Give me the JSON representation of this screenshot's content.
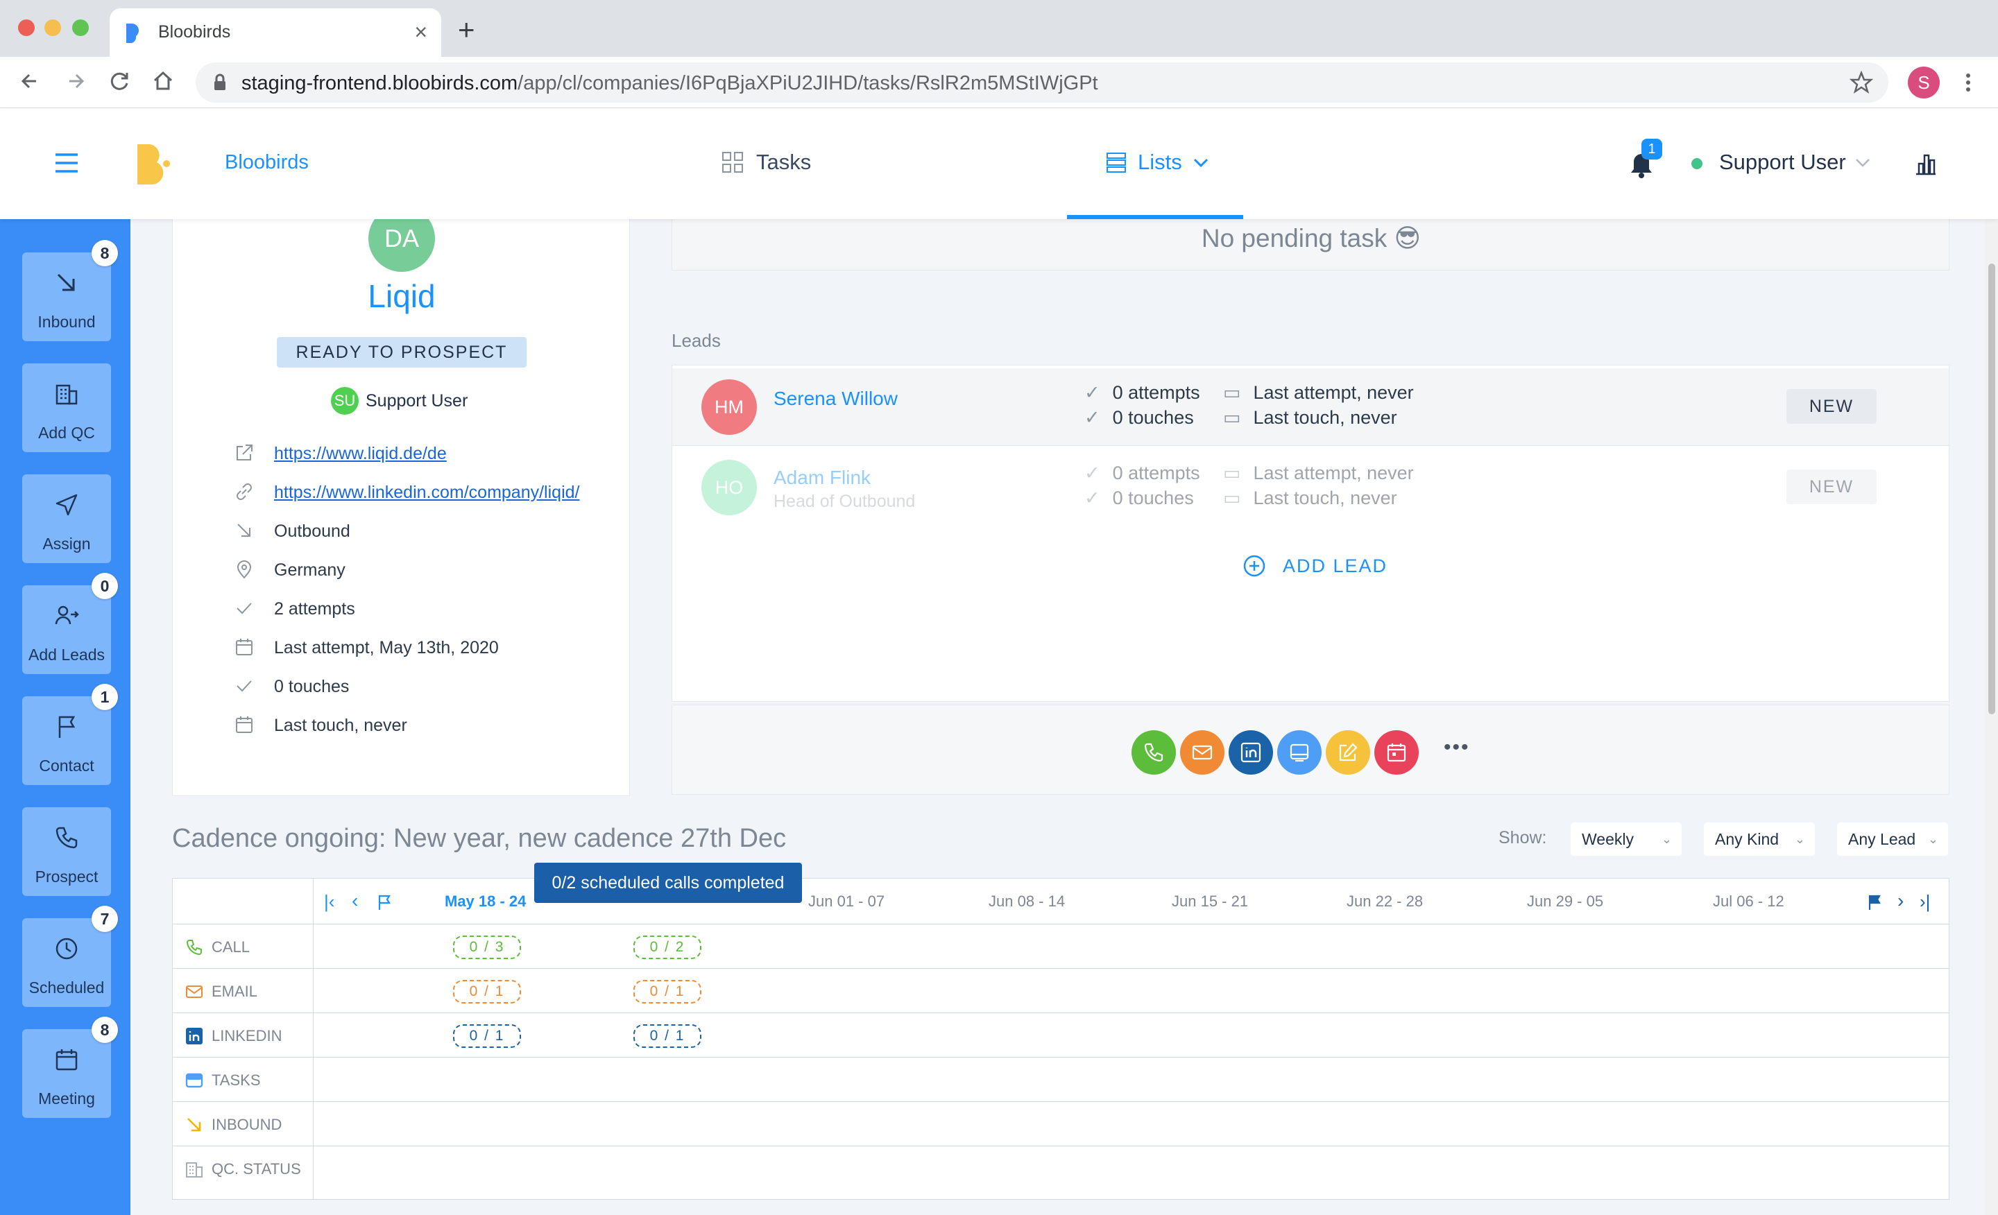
{
  "browser": {
    "tab_title": "Bloobirds",
    "url_host": "staging-frontend.bloobirds.com",
    "url_path": "/app/cl/companies/I6PqBjaXPiU2JIHD/tasks/RslR2m5MStIWjGPt",
    "profile_initial": "S"
  },
  "header": {
    "brand": "Bloobirds",
    "nav_tasks": "Tasks",
    "nav_lists": "Lists",
    "bell_count": "1",
    "user_name": "Support User"
  },
  "sidebar": {
    "items": [
      {
        "label": "Inbound",
        "badge": "8",
        "icon": "arrow-down-right-icon"
      },
      {
        "label": "Add QC",
        "badge": "",
        "icon": "building-icon"
      },
      {
        "label": "Assign",
        "badge": "",
        "icon": "send-icon"
      },
      {
        "label": "Add Leads",
        "badge": "0",
        "icon": "user-arrow-icon"
      },
      {
        "label": "Contact",
        "badge": "1",
        "icon": "flag-icon"
      },
      {
        "label": "Prospect",
        "badge": "",
        "icon": "phone-icon"
      },
      {
        "label": "Scheduled",
        "badge": "7",
        "icon": "clock-icon"
      },
      {
        "label": "Meeting",
        "badge": "8",
        "icon": "calendar-icon"
      }
    ]
  },
  "company": {
    "initials": "DA",
    "name": "Liqid",
    "status": "READY TO PROSPECT",
    "owner_initials": "SU",
    "owner_name": "Support User",
    "website": "https://www.liqid.de/de",
    "linkedin": "https://www.linkedin.com/company/liqid/",
    "source": "Outbound",
    "country": "Germany",
    "attempts": "2 attempts",
    "last_attempt": "Last attempt, May 13th, 2020",
    "touches": "0 touches",
    "last_touch": "Last touch, never"
  },
  "tasks_panel": {
    "empty_text": "No pending task 😎"
  },
  "leads": {
    "label": "Leads",
    "add_lead": "ADD LEAD",
    "rows": [
      {
        "initials": "HM",
        "name": "Serena Willow",
        "title": "",
        "attempts": "0 attempts",
        "touches": "0 touches",
        "last_attempt": "Last attempt, never",
        "last_touch": "Last touch, never",
        "status": "NEW",
        "avatar_color": "#f07c82"
      },
      {
        "initials": "HO",
        "name": "Adam Flink",
        "title": "Head of Outbound",
        "attempts": "0 attempts",
        "touches": "0 touches",
        "last_attempt": "Last attempt, never",
        "last_touch": "Last touch, never",
        "status": "NEW",
        "avatar_color": "#7ee3b0"
      }
    ]
  },
  "actions": {
    "colors": {
      "call": "#5bbd3a",
      "email": "#f08a34",
      "linkedin": "#1b63a8",
      "task": "#4f9ef5",
      "note": "#f7c23b",
      "meeting": "#e8435a"
    },
    "more": "•••"
  },
  "cadence": {
    "title": "Cadence ongoing: New year, new cadence 27th Dec",
    "show_label": "Show:",
    "filters": [
      "Weekly",
      "Any Kind",
      "Any Lead"
    ],
    "tooltip": "0/2 scheduled calls completed",
    "weeks": [
      "May 18 - 24",
      "",
      "Jun 01 - 07",
      "Jun 08 - 14",
      "Jun 15 - 21",
      "Jun 22 - 28",
      "Jun 29 - 05",
      "Jul 06 - 12"
    ],
    "rows": [
      {
        "label": "CALL",
        "cells": [
          "0 / 3",
          "0 / 2"
        ]
      },
      {
        "label": "EMAIL",
        "cells": [
          "0 / 1",
          "0 / 1"
        ]
      },
      {
        "label": "LINKEDIN",
        "cells": [
          "0 / 1",
          "0 / 1"
        ]
      },
      {
        "label": "TASKS",
        "cells": []
      },
      {
        "label": "INBOUND",
        "cells": []
      },
      {
        "label": "QC. STATUS",
        "cells": []
      }
    ]
  }
}
